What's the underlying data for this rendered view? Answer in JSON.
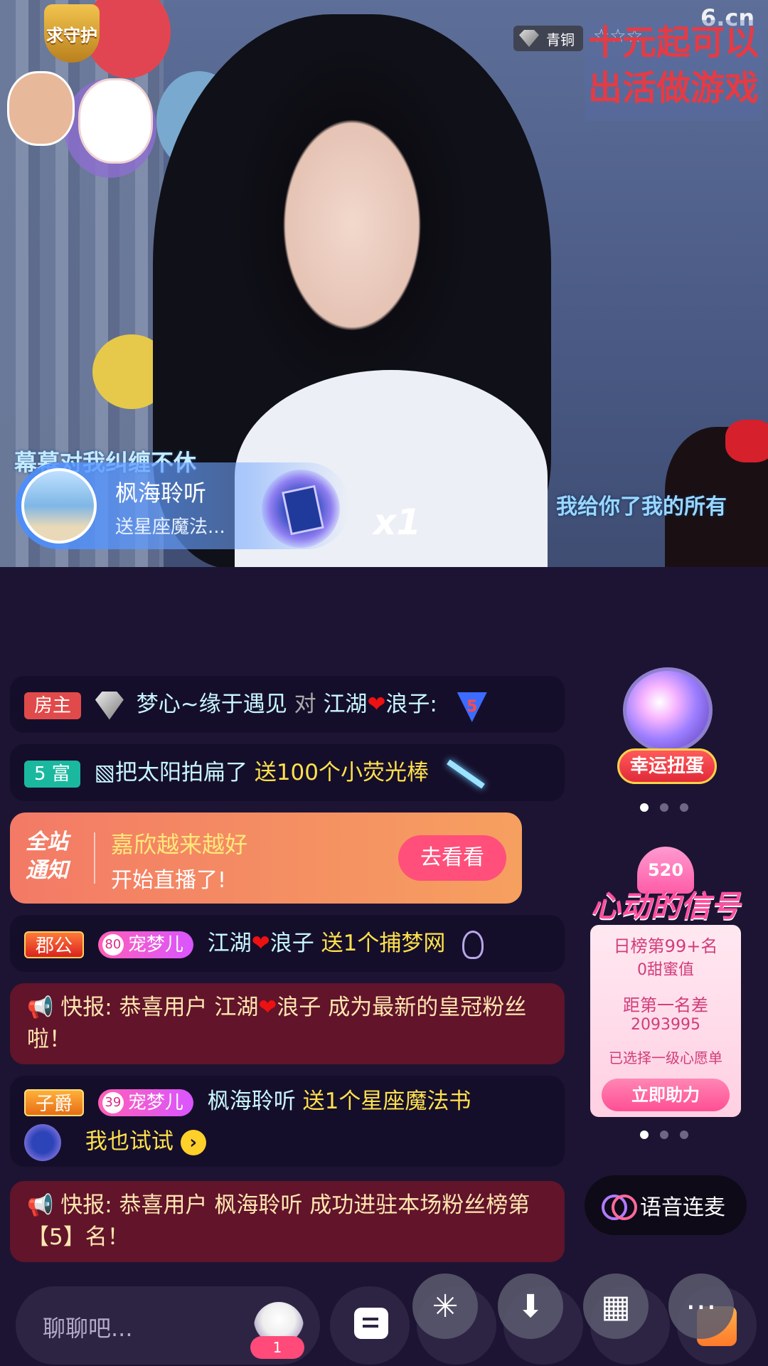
{
  "stream": {
    "guardian_badge": "求守护",
    "rank_label": "青铜",
    "stars": "☆☆☆",
    "site_logo": "6.cn",
    "overlay_text": "十元起可以出活做游戏",
    "subtitle_left": "幕幕对我纠缠不休",
    "subtitle_right": "我给你了我的所有"
  },
  "gift_banner": {
    "user": "枫海聆听",
    "action": "送星座魔法...",
    "multiplier": "x1"
  },
  "feed": [
    {
      "tag": "房主",
      "text_a": "梦心~缘于遇见",
      "mid": "对",
      "text_b": "江湖",
      "text_c": "浪子:",
      "level": "5"
    },
    {
      "tag": "5 富",
      "text_a": "▧把太阳拍扁了",
      "gift": "送100个小荧光棒"
    },
    {
      "tag": "郡公",
      "fan": "宠梦儿",
      "fan_level": "80",
      "text_a": "江湖",
      "text_c": "浪子",
      "gift": "送1个捕梦网"
    },
    {
      "flash": "快报: 恭喜用户 江湖",
      "flash2": "浪子 成为最新的皇冠粉丝啦！"
    },
    {
      "tag": "子爵",
      "fan": "宠梦儿",
      "fan_level": "39",
      "text_a": "枫海聆听",
      "gift": "送1个星座魔法书",
      "try": "我也试试"
    },
    {
      "flash": "快报: 恭喜用户 枫海聆听 成功进驻本场粉丝榜第【5】名！"
    }
  ],
  "notice": {
    "label_a": "全站",
    "label_b": "通知",
    "streamer": "嘉欣越来越好",
    "msg": "开始直播了!",
    "button": "去看看"
  },
  "capsule": {
    "label": "幸运扭蛋"
  },
  "signal": {
    "badge": "520",
    "title": "心动的信号",
    "line1": "日榜第99+名",
    "line2": "0甜蜜值",
    "line3": "距第一名差",
    "line4": "2093995",
    "line5": "已选择一级心愿单",
    "button": "立即助力"
  },
  "voice": {
    "label": "语音连麦"
  },
  "bottom": {
    "placeholder": "聊聊吧...",
    "badge": "1"
  },
  "colors": {
    "accent": "#ff4f7a",
    "bg": "#1d1433",
    "gift_text": "#ffe14d"
  }
}
